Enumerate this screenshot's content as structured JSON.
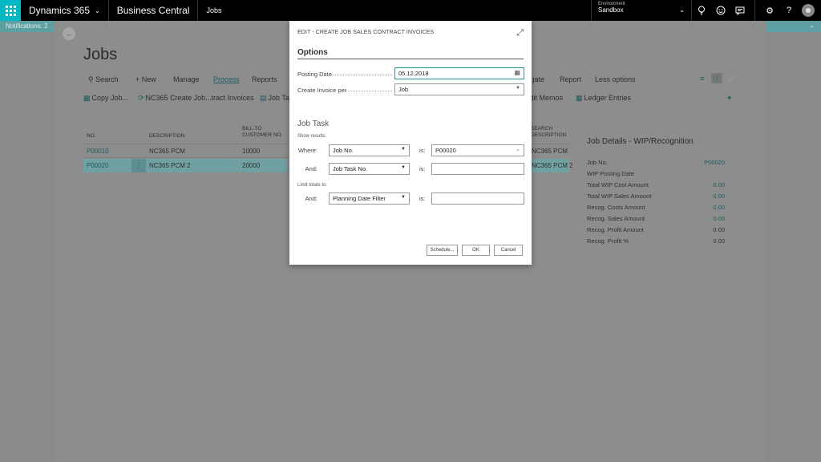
{
  "topbar": {
    "product": "Dynamics 365",
    "app": "Business Central",
    "page": "Jobs",
    "environment_label": "Environment",
    "environment_value": "Sandbox"
  },
  "notification": {
    "text": "Notifications: 2"
  },
  "page": {
    "title": "Jobs",
    "actions": [
      "Search",
      "New",
      "Manage",
      "Process",
      "Reports",
      "Navigate",
      "Report",
      "Less options"
    ],
    "actions_row2": [
      "Copy Job...",
      "NC365 Create Job...tract Invoices",
      "Job Task",
      "Credit Memos",
      "Ledger Entries"
    ],
    "columns": {
      "no": "NO.",
      "description": "DESCRIPTION",
      "bill_to": "BILL-TO CUSTOMER NO.",
      "search_desc": "SEARCH DESCRIPTION"
    },
    "rows": [
      {
        "no": "P00010",
        "description": "NC365 PCM",
        "bill_to": "10000",
        "search": "NC365 PCM"
      },
      {
        "no": "P00020",
        "description": "NC365 PCM 2",
        "bill_to": "20000",
        "search": "NC365 PCM 2"
      }
    ]
  },
  "factbox": {
    "title": "Job Details - WIP/Recognition",
    "rows": [
      {
        "label": "Job No.",
        "value": "P00020"
      },
      {
        "label": "WIP Posting Date",
        "value": ""
      },
      {
        "label": "Total WIP Cost Amount",
        "value": "0.00"
      },
      {
        "label": "Total WIP Sales Amount",
        "value": "0.00"
      },
      {
        "label": "Recog. Costs Amount",
        "value": "0.00"
      },
      {
        "label": "Recog. Sales Amount",
        "value": "0.00"
      },
      {
        "label": "Recog. Profit Amount",
        "value": "0.00"
      },
      {
        "label": "Recog. Profit %",
        "value": "0.00"
      }
    ]
  },
  "dialog": {
    "caption": "EDIT - CREATE JOB SALES CONTRACT INVOICES",
    "options_title": "Options",
    "posting_date_label": "Posting Date",
    "posting_date_value": "05.12.2018",
    "create_invoice_label": "Create Invoice per",
    "create_invoice_value": "Job",
    "job_task_title": "Job Task",
    "show_results": "Show results:",
    "where_label": "Where:",
    "and_label": "And:",
    "is_label": "is:",
    "filter1_field": "Job No.",
    "filter1_value": "P00020",
    "filter2_field": "Job Task No.",
    "filter2_value": "",
    "limit_totals": "Limit totals to:",
    "filter3_field": "Planning Date Filter",
    "filter3_value": "",
    "schedule_btn": "Schedule...",
    "ok_btn": "OK",
    "cancel_btn": "Cancel"
  }
}
